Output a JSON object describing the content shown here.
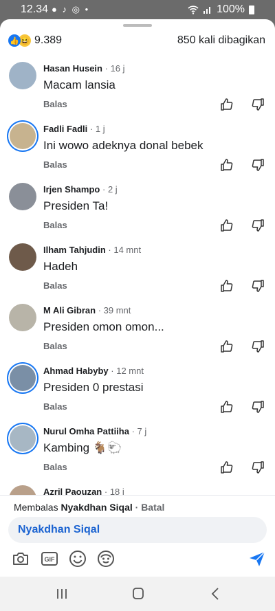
{
  "status": {
    "time": "12.34",
    "battery": "100%"
  },
  "header": {
    "reaction_count": "9.389",
    "shares": "850 kali dibagikan"
  },
  "comments": [
    {
      "name": "Hasan Husein",
      "time": "16 j",
      "text": "Macam lansia",
      "reply": "Balas",
      "avatar_color": "#9fb3c7"
    },
    {
      "name": "Fadli Fadli",
      "time": "1 j",
      "text": "Ini wowo adeknya donal bebek",
      "reply": "Balas",
      "avatar_color": "#c7b38f"
    },
    {
      "name": "Irjen Shampo",
      "time": "2 j",
      "text": "Presiden Ta!",
      "reply": "Balas",
      "avatar_color": "#8a8f98"
    },
    {
      "name": "Ilham Tahjudin",
      "time": "14 mnt",
      "text": "Hadeh",
      "reply": "Balas",
      "avatar_color": "#6e5a4a"
    },
    {
      "name": "M Ali Gibran",
      "time": "39 mnt",
      "text": "Presiden omon omon...",
      "reply": "Balas",
      "avatar_color": "#b8b4a8"
    },
    {
      "name": "Ahmad Habyby",
      "time": "12 mnt",
      "text": "Presiden 0 prestasi",
      "reply": "Balas",
      "avatar_color": "#7a8fa6"
    },
    {
      "name": "Nurul Omha Pattiiha",
      "time": "7 j",
      "text": "Kambing 🐐🐑",
      "reply": "Balas",
      "avatar_color": "#a7b7c4"
    },
    {
      "name": "Azril Paouzan",
      "time": "18 j",
      "text": "",
      "reply": "",
      "avatar_color": "#b9a08a"
    }
  ],
  "reply_bar": {
    "prefix": "Membalas",
    "target": "Nyakdhan Siqal",
    "cancel": "· Batal",
    "mention": "Nyakdhan Siqal"
  },
  "icons": [
    "camera-icon",
    "gif-icon",
    "emoji-icon",
    "avatar-sticker-icon",
    "send-icon"
  ],
  "colors": {
    "accent": "#1877f2",
    "mention": "#1b63d1",
    "muted": "#65676b"
  }
}
